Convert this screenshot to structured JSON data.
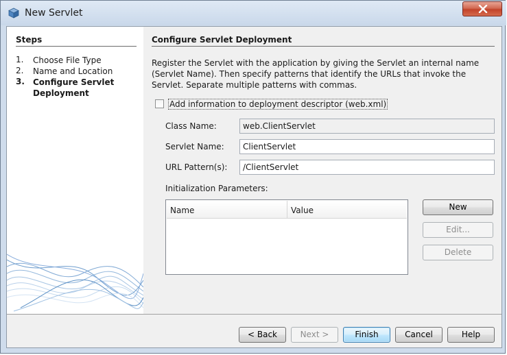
{
  "window": {
    "title": "New Servlet",
    "close_icon": "close-icon",
    "app_icon": "netbeans-cube-icon"
  },
  "steps": {
    "title": "Steps",
    "items": [
      {
        "num": "1.",
        "label": "Choose File Type",
        "current": false
      },
      {
        "num": "2.",
        "label": "Name and Location",
        "current": false
      },
      {
        "num": "3.",
        "label": "Configure Servlet Deployment",
        "current": true
      }
    ]
  },
  "main": {
    "title": "Configure Servlet Deployment",
    "description": "Register the Servlet with the application by giving the Servlet an internal name (Servlet Name). Then specify patterns that identify the URLs that invoke the Servlet. Separate multiple patterns with commas.",
    "checkbox": {
      "label": "Add information to deployment descriptor (web.xml)",
      "checked": false
    },
    "class_name": {
      "label": "Class Name:",
      "value": "web.ClientServlet"
    },
    "servlet_name": {
      "label": "Servlet Name:",
      "value": "ClientServlet"
    },
    "url_pattern": {
      "label": "URL Pattern(s):",
      "value": "/ClientServlet"
    },
    "init_params": {
      "label": "Initialization Parameters:",
      "columns": [
        "Name",
        "Value"
      ],
      "rows": []
    },
    "new_button": "New",
    "edit_button": "Edit...",
    "delete_button": "Delete"
  },
  "footer": {
    "back": "< Back",
    "next": "Next >",
    "finish": "Finish",
    "cancel": "Cancel",
    "help": "Help"
  },
  "colors": {
    "title_gradient": "#c9d8ea",
    "close_red": "#c2432a",
    "default_button_border": "#3c7fb1"
  }
}
